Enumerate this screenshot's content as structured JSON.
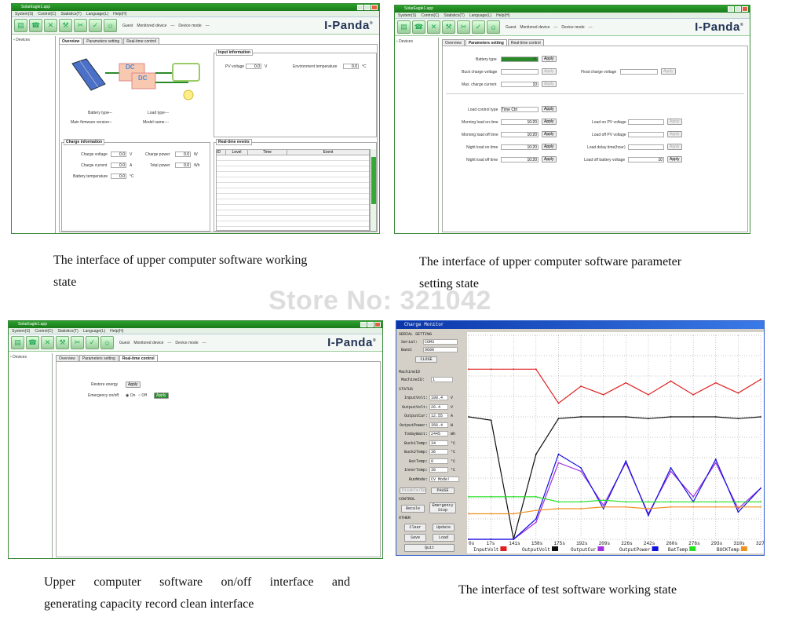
{
  "app": {
    "title": "SolarEagle1.app",
    "menu": [
      "System(S)",
      "Control(C)",
      "Statistics(T)",
      "Language(L)",
      "Help(H)"
    ],
    "status_guest": "Guest",
    "status_monitored": "Monitored device",
    "status_dash1": "---",
    "status_mode": "Device mode",
    "status_dash2": "---",
    "logo": "I-Panda",
    "logo_reg": "®",
    "devices": "Devices",
    "tabs": [
      "Overview",
      "Parameters setting",
      "Real-time control"
    ]
  },
  "win1": {
    "input_info": "Input information",
    "pv_voltage_label": "PV voltage",
    "pv_voltage": "0.0",
    "unit_v": "V",
    "env_temp_label": "Environment temperature",
    "env_temp": "0.0",
    "unit_c": "°C",
    "battery_type_label": "Battery type",
    "battery_type": "---",
    "load_type_label": "Load type",
    "load_type": "---",
    "firmware_label": "Main firmware version",
    "firmware": "---",
    "model_label": "Model name",
    "model": "---",
    "dc1": "DC",
    "dc2": "DC",
    "charge_info": "Charge information",
    "charge_voltage_label": "Charge voltage",
    "charge_voltage": "0.0",
    "unit_v2": "V",
    "charge_power_label": "Charge power",
    "charge_power": "0.0",
    "unit_w": "W",
    "charge_current_label": "Charge current",
    "charge_current": "0.0",
    "unit_a": "A",
    "total_power_label": "Total power",
    "total_power": "0.0",
    "unit_wh": "Wh",
    "battery_temp_label": "Battery temperature",
    "battery_temp": "0.0",
    "unit_c2": "°C",
    "events": "Real-time events",
    "ev_cols": [
      "ID",
      "Level",
      "Time",
      "Event"
    ]
  },
  "win2": {
    "battery_type_label": "Battery type",
    "apply": "Apply",
    "buck_label": "Buck charge voltage",
    "float_label": "Float charge voltage",
    "max_label": "Max. charge current",
    "max_val": "10",
    "load_control_label": "Load control type",
    "load_control": "Time Ctrl",
    "rows": [
      {
        "l": "Morning load on time",
        "v": "10:20",
        "r": "Load on PV voltage",
        "rv": ""
      },
      {
        "l": "Morning load off time",
        "v": "10:20",
        "r": "Load off PV voltage",
        "rv": ""
      },
      {
        "l": "Night load on time",
        "v": "10:20",
        "r": "Load delay time(hour)",
        "rv": ""
      },
      {
        "l": "Night load off time",
        "v": "10:20",
        "r": "Load off battery voltage",
        "rv": "10"
      }
    ]
  },
  "win3": {
    "restore_label": "Restore energy",
    "apply": "Apply",
    "emergency_label": "Emergency on/off",
    "on": "On",
    "off": "Off",
    "apply2": "Apply"
  },
  "win4": {
    "title": "Charge Monitor",
    "serial_setting": "SERIAL SETTING",
    "serial_label": "Serial:",
    "serial": "COM3",
    "band_label": "Band:",
    "band": "9600",
    "close": "CLOSE",
    "machineid_sec": "MachineID",
    "machineid_label": "MachineID:",
    "machineid": "1",
    "status_sec": "STATUS",
    "fields": [
      {
        "l": "InputVolt:",
        "v": "100.4",
        "u": "V"
      },
      {
        "l": "OutputVolt:",
        "v": "26.4",
        "u": "V"
      },
      {
        "l": "OutputCur:",
        "v": "12.55",
        "u": "A"
      },
      {
        "l": "OutputPower:",
        "v": "356.4",
        "u": "W"
      },
      {
        "l": "TodayWatt:",
        "v": "2445",
        "u": "Wh"
      },
      {
        "l": "Buck1Temp:",
        "v": "34",
        "u": "°C"
      },
      {
        "l": "Buck2Temp:",
        "v": "36",
        "u": "°C"
      },
      {
        "l": "BatTemp:",
        "v": "0",
        "u": "°C"
      },
      {
        "l": "InnerTemp:",
        "v": "30",
        "u": "°C"
      },
      {
        "l": "RunMode:",
        "v": "CV Mode!",
        "u": ""
      }
    ],
    "disable": "Disable/En",
    "pause": "PAUSE",
    "control_sec": "CONTROL",
    "recale": "Recale",
    "estop1": "Emergency",
    "estop2": "Stop",
    "other_sec": "OTHER",
    "clear": "Clear",
    "update": "Update",
    "save": "Save",
    "load": "Load",
    "quit": "Quit"
  },
  "captions": {
    "c1a": "The interface of upper computer software working",
    "c1b": "state",
    "c2a": "The interface of upper computer software parameter",
    "c2b": "setting state",
    "c3a": "Upper computer software on/off interface and",
    "c3b": "generating capacity record clean interface",
    "c4": "The interface of test software working state"
  },
  "watermark": "Store No: 321042",
  "chart_data": {
    "type": "line",
    "x": [
      "0s",
      "17s",
      "141s",
      "158s",
      "175s",
      "192s",
      "209s",
      "226s",
      "242s",
      "260s",
      "276s",
      "293s",
      "310s",
      "327s"
    ],
    "legend_position": "bottom",
    "series": [
      {
        "name": "InputVolt",
        "color": "#e02020",
        "values": [
          100,
          100,
          100,
          100,
          80,
          90,
          85,
          92,
          85,
          93,
          85,
          92,
          86,
          94
        ]
      },
      {
        "name": "OutputVolt",
        "color": "#101010",
        "values": [
          72,
          70,
          0,
          50,
          71,
          72,
          72,
          72,
          71,
          72,
          72,
          72,
          71,
          72
        ]
      },
      {
        "name": "OutputCur",
        "color": "#a030e0",
        "values": [
          0,
          0,
          0,
          10,
          45,
          40,
          20,
          45,
          15,
          40,
          25,
          45,
          18,
          30
        ]
      },
      {
        "name": "OutputPower",
        "color": "#1010e0",
        "values": [
          0,
          0,
          0,
          12,
          50,
          42,
          18,
          46,
          14,
          42,
          22,
          47,
          16,
          30
        ]
      },
      {
        "name": "BatTemp",
        "color": "#20e020",
        "values": [
          25,
          25,
          25,
          25,
          22,
          22,
          23,
          22,
          22,
          22,
          22,
          22,
          22,
          22
        ]
      },
      {
        "name": "BUCKTemp",
        "color": "#f09020",
        "values": [
          15,
          15,
          15,
          17,
          18,
          18,
          19,
          19,
          18,
          19,
          19,
          19,
          19,
          19
        ]
      }
    ]
  }
}
